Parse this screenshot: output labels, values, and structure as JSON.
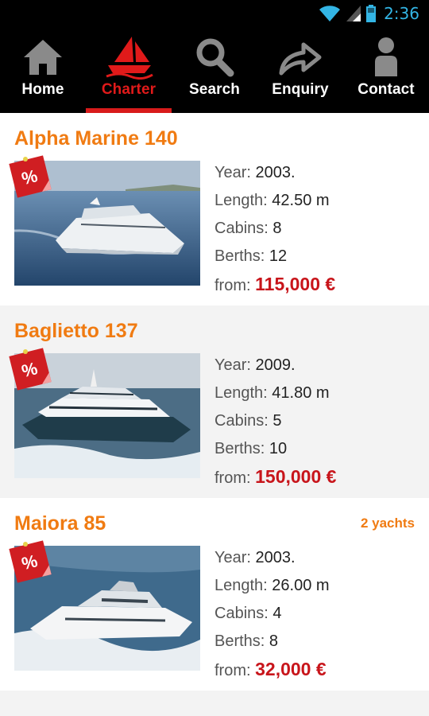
{
  "status": {
    "time": "2:36"
  },
  "nav": {
    "items": [
      {
        "label": "Home",
        "icon": "home-icon"
      },
      {
        "label": "Charter",
        "icon": "sailboat-icon",
        "active": true
      },
      {
        "label": "Search",
        "icon": "search-icon"
      },
      {
        "label": "Enquiry",
        "icon": "share-arrow-icon"
      },
      {
        "label": "Contact",
        "icon": "person-icon"
      }
    ]
  },
  "colors": {
    "accent": "#e01a1a",
    "title": "#f07b12",
    "price": "#c8151b"
  },
  "labels": {
    "year": "Year:",
    "length": "Length:",
    "cabins": "Cabins:",
    "berths": "Berths:",
    "from": "from:"
  },
  "discount_badge": "%",
  "yachts": [
    {
      "name": "Alpha Marine 140",
      "badge": "",
      "year": "2003.",
      "length": "42.50 m",
      "cabins": "8",
      "berths": "12",
      "price": "115,000 €"
    },
    {
      "name": "Baglietto 137",
      "badge": "",
      "year": "2009.",
      "length": "41.80 m",
      "cabins": "5",
      "berths": "10",
      "price": "150,000 €"
    },
    {
      "name": "Maiora 85",
      "badge": "2 yachts",
      "year": "2003.",
      "length": "26.00 m",
      "cabins": "4",
      "berths": "8",
      "price": "32,000 €"
    }
  ]
}
